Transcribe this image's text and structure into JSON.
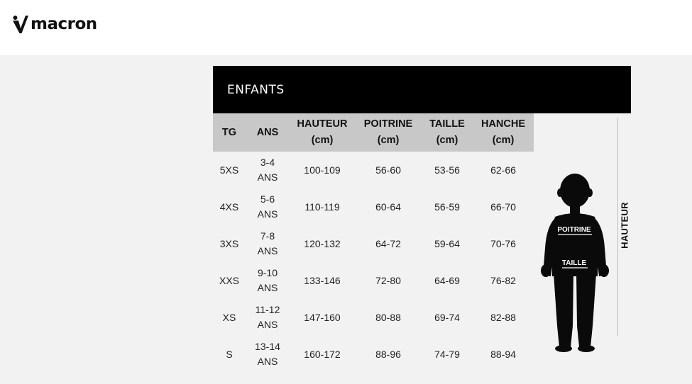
{
  "brand": {
    "name": "macron"
  },
  "panel": {
    "title": "ENFANTS"
  },
  "table": {
    "headers": [
      [
        "TG"
      ],
      [
        "ANS"
      ],
      [
        "HAUTEUR",
        "(cm)"
      ],
      [
        "POITRINE",
        "(cm)"
      ],
      [
        "TAILLE",
        "(cm)"
      ],
      [
        "HANCHE",
        "(cm)"
      ]
    ],
    "rows": [
      {
        "tg": "5XS",
        "ans": [
          "3-4",
          "ANS"
        ],
        "hauteur": "100-109",
        "poitrine": "56-60",
        "taille": "53-56",
        "hanche": "62-66"
      },
      {
        "tg": "4XS",
        "ans": [
          "5-6",
          "ANS"
        ],
        "hauteur": "110-119",
        "poitrine": "60-64",
        "taille": "56-59",
        "hanche": "66-70"
      },
      {
        "tg": "3XS",
        "ans": [
          "7-8",
          "ANS"
        ],
        "hauteur": "120-132",
        "poitrine": "64-72",
        "taille": "59-64",
        "hanche": "70-76"
      },
      {
        "tg": "XXS",
        "ans": [
          "9-10",
          "ANS"
        ],
        "hauteur": "133-146",
        "poitrine": "72-80",
        "taille": "64-69",
        "hanche": "76-82"
      },
      {
        "tg": "XS",
        "ans": [
          "11-12",
          "ANS"
        ],
        "hauteur": "147-160",
        "poitrine": "80-88",
        "taille": "69-74",
        "hanche": "82-88"
      },
      {
        "tg": "S",
        "ans": [
          "13-14",
          "ANS"
        ],
        "hauteur": "160-172",
        "poitrine": "88-96",
        "taille": "74-79",
        "hanche": "88-94"
      }
    ]
  },
  "figure": {
    "chest_label": "POITRINE",
    "waist_label": "TAILLE",
    "height_label": "HAUTEUR"
  },
  "colors": {
    "header_bg": "#000000",
    "column_header_bg": "#c8c8c8",
    "page_bg": "#f2f2f2",
    "topbar_bg": "#ffffff"
  }
}
